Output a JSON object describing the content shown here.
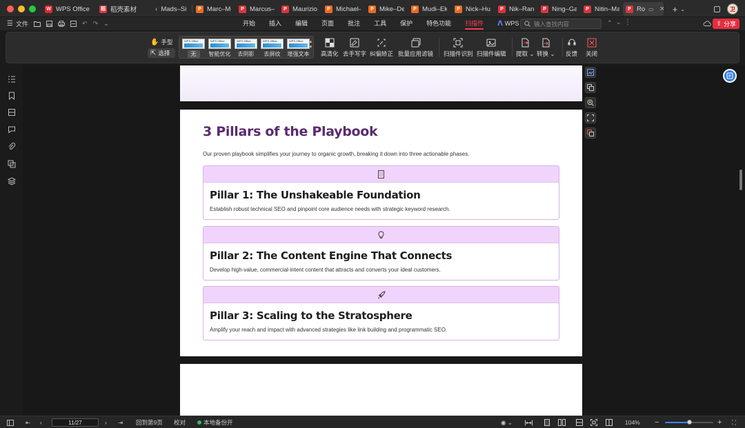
{
  "tabs": [
    {
      "label": "WPS Office",
      "icon": "wps-logo-icon",
      "active": false
    },
    {
      "label": "稻壳素材",
      "icon": "daoke-icon",
      "active": false
    },
    {
      "label": "Mads–Si",
      "icon": "none",
      "active": false
    },
    {
      "label": "Marc–Mc",
      "icon": "pdf-icon",
      "active": false
    },
    {
      "label": "Marcus–",
      "icon": "wps-doc-icon",
      "active": false
    },
    {
      "label": "Maurizio",
      "icon": "wps-doc-icon",
      "active": false
    },
    {
      "label": "Michael–",
      "icon": "pdf-icon",
      "active": false
    },
    {
      "label": "Mike–De",
      "icon": "pdf-icon",
      "active": false
    },
    {
      "label": "Mudi–Ek",
      "icon": "pdf-icon",
      "active": false
    },
    {
      "label": "Nick–Hu",
      "icon": "pdf-icon",
      "active": false
    },
    {
      "label": "Nik–Ran",
      "icon": "wps-doc-icon",
      "active": false
    },
    {
      "label": "Ning–Ga",
      "icon": "wps-doc-icon",
      "active": false
    },
    {
      "label": "Nitin–Ma",
      "icon": "wps-doc-icon",
      "active": false
    },
    {
      "label": "Ro",
      "icon": "wps-doc-icon",
      "active": true
    }
  ],
  "menubar": {
    "file_label": "文件",
    "items": [
      "开始",
      "插入",
      "编辑",
      "页面",
      "批注",
      "工具",
      "保护",
      "特色功能",
      "扫描件",
      "WPS AI"
    ],
    "active_item": "扫描件",
    "search_placeholder": "输入查找内容",
    "share_label": "分享"
  },
  "ribbon": {
    "hand_label": "手型",
    "select_label": "选择",
    "filter_brand": "WPS Office",
    "filters": [
      {
        "label": "无",
        "selected": true
      },
      {
        "label": "智能优化",
        "selected": false
      },
      {
        "label": "去阴影",
        "selected": false
      },
      {
        "label": "去屏纹",
        "selected": false
      },
      {
        "label": "增强文本",
        "selected": false
      }
    ],
    "tools": [
      {
        "label": "高清化",
        "icon": "hd-icon"
      },
      {
        "label": "去手写字",
        "icon": "remove-handwriting-icon"
      },
      {
        "label": "纠偏矫正",
        "icon": "deskew-icon"
      },
      {
        "label": "批量应用滤镜",
        "icon": "batch-filter-icon"
      },
      {
        "label": "扫描件识别",
        "icon": "scan-recognize-icon"
      },
      {
        "label": "扫描件编辑",
        "icon": "scan-edit-icon"
      },
      {
        "label": "提取",
        "icon": "extract-icon"
      },
      {
        "label": "转换",
        "icon": "convert-icon"
      },
      {
        "label": "反馈",
        "icon": "feedback-icon"
      },
      {
        "label": "关闭",
        "icon": "close-icon"
      }
    ]
  },
  "document": {
    "title": "3 Pillars of the Playbook",
    "intro": "Our proven playbook simplifies your journey to organic growth, breaking it down into three actionable phases.",
    "pillars": [
      {
        "icon": "building-icon",
        "title": "Pillar 1: The Unshakeable Foundation",
        "desc": "Establish robust technical SEO and pinpoint core audience needs with strategic keyword research."
      },
      {
        "icon": "lightbulb-icon",
        "title": "Pillar 2: The Content Engine That Connects",
        "desc": "Develop high-value, commercial-intent content that attracts and converts your ideal customers."
      },
      {
        "icon": "rocket-icon",
        "title": "Pillar 3: Scaling to the Stratosphere",
        "desc": "Amplify your reach and impact with advanced strategies like link building and programmatic SEO."
      }
    ]
  },
  "statusbar": {
    "page_value": "11/27",
    "back_label": "回到第9页",
    "proof_label": "校对",
    "backup_label": "本地备份开",
    "zoom": "104%",
    "zoom_fraction": 0.52
  },
  "colors": {
    "accent": "#ff3a4f",
    "title_purple": "#5a2c6e",
    "pillar_band": "#f0d4fb",
    "pillar_border": "#d6b2e6"
  }
}
